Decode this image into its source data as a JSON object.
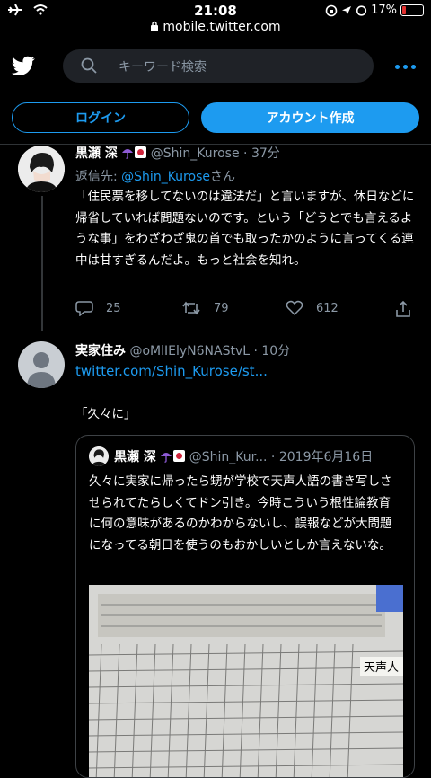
{
  "status_bar": {
    "time": "21:08",
    "url": "mobile.twitter.com",
    "battery": "17%",
    "battery_level": 0.17
  },
  "header": {
    "search_placeholder": "キーワード検索"
  },
  "auth": {
    "login": "ログイン",
    "signup": "アカウント作成"
  },
  "tweet1": {
    "name": "黒瀬 深",
    "handle": "@Shin_Kurose",
    "time": "37分",
    "reply_prefix": "返信先: ",
    "reply_handle": "@Shin_Kurose",
    "reply_suffix": "さん",
    "text": "「住民票を移してないのは違法だ」と言いますが、休日などに帰省していれば問題ないのです。という「どうとでも言えるような事」をわざわざ鬼の首でも取ったかのように言ってくる連中は甘すぎるんだよ。もっと社会を知れ。",
    "replies": "25",
    "retweets": "79",
    "likes": "612"
  },
  "tweet2": {
    "name": "実家住み",
    "handle": "@oMlIElyN6NAStvL",
    "time": "10分",
    "link": "twitter.com/Shin_Kurose/st...",
    "text": "「久々に」"
  },
  "quote": {
    "name": "黒瀬 深",
    "handle": "@Shin_Kur...",
    "date": "2019年6月16日",
    "text": "久々に実家に帰ったら甥が学校で天声人語の書き写しさせられてたらしくてドン引き。今時こういう根性論教育に何の意味があるのかわからないし、誤報などが大問題になってる朝日を使うのもおかしいとしか言えないな。",
    "image_caption": "天声人"
  },
  "colors": {
    "accent": "#1d9bf0",
    "muted": "#8b98a5",
    "background": "#000000"
  },
  "icons": [
    "airplane-icon",
    "wifi-icon",
    "lock-icon",
    "twitter-bird-icon",
    "search-icon",
    "more-icon",
    "reply-icon",
    "retweet-icon",
    "like-icon",
    "share-icon",
    "umbrella-icon",
    "flag-icon"
  ]
}
